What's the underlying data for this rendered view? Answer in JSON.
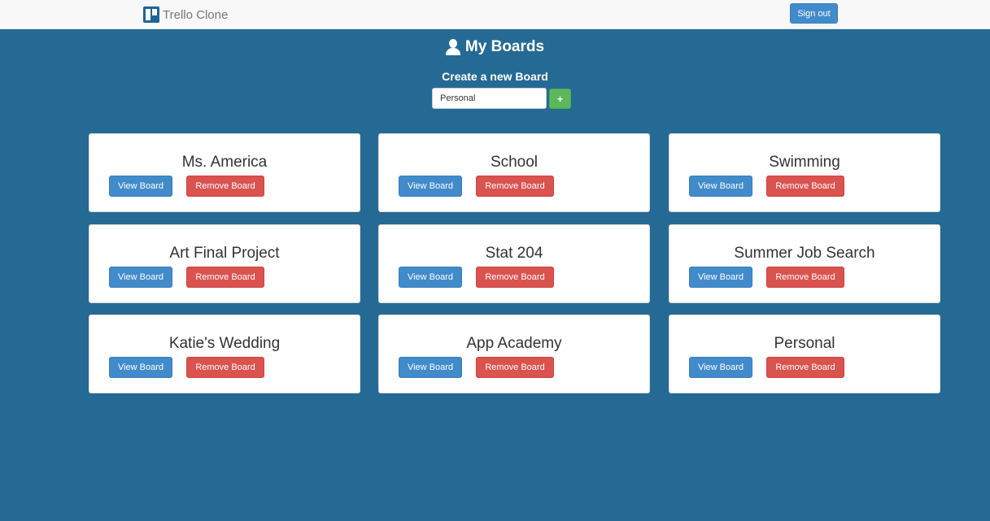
{
  "navbar": {
    "brand": "Trello Clone",
    "signout_label": "Sign out"
  },
  "header": {
    "title": "My Boards",
    "create_label": "Create a new Board",
    "input_value": "Personal",
    "add_label": "+"
  },
  "boards": [
    {
      "name": "Ms. America",
      "view_label": "View Board",
      "remove_label": "Remove Board"
    },
    {
      "name": "School",
      "view_label": "View Board",
      "remove_label": "Remove Board"
    },
    {
      "name": "Swimming",
      "view_label": "View Board",
      "remove_label": "Remove Board"
    },
    {
      "name": "Art Final Project",
      "view_label": "View Board",
      "remove_label": "Remove Board"
    },
    {
      "name": "Stat 204",
      "view_label": "View Board",
      "remove_label": "Remove Board"
    },
    {
      "name": "Summer Job Search",
      "view_label": "View Board",
      "remove_label": "Remove Board"
    },
    {
      "name": "Katie's Wedding",
      "view_label": "View Board",
      "remove_label": "Remove Board"
    },
    {
      "name": "App Academy",
      "view_label": "View Board",
      "remove_label": "Remove Board"
    },
    {
      "name": "Personal",
      "view_label": "View Board",
      "remove_label": "Remove Board"
    }
  ],
  "colors": {
    "background": "#256a94",
    "primary": "#428bca",
    "danger": "#d9534f",
    "success": "#5cb85c"
  }
}
